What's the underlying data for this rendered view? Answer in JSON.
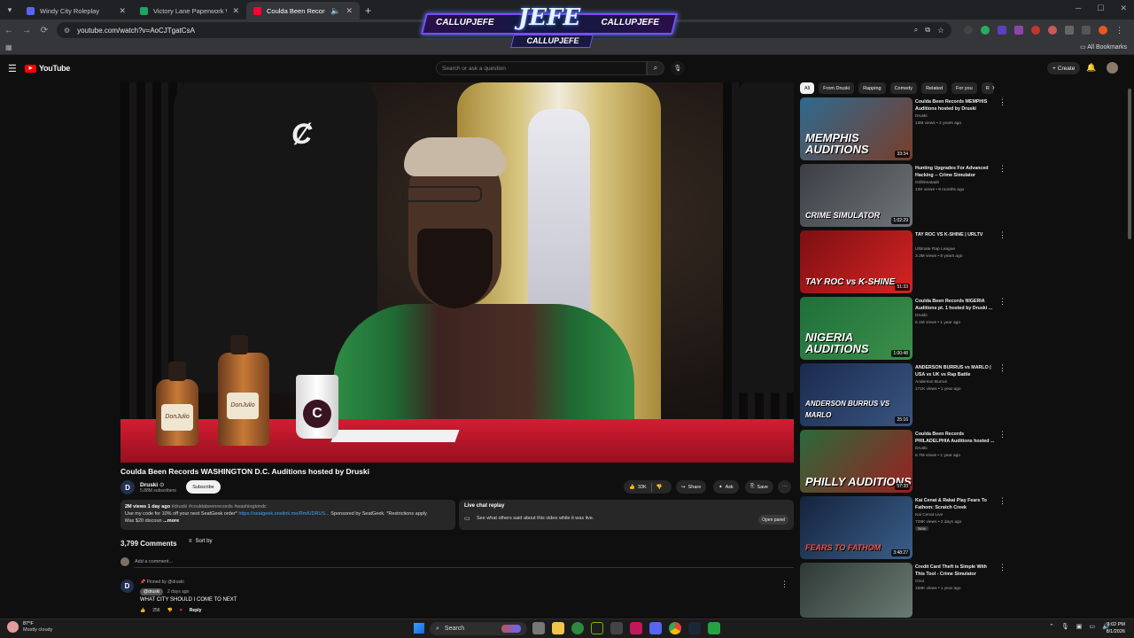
{
  "browser": {
    "tabs": [
      {
        "title": "Windy City Roleplay",
        "favicon_color": "#5865f2"
      },
      {
        "title": "Victory Lane Paperwork WCRP",
        "favicon_color": "#1fa463"
      },
      {
        "title": "Coulda Been Records WASHI",
        "favicon_color": "#ff0033",
        "active": true
      }
    ],
    "url": "youtube.com/watch?v=AoCJTgatCsA",
    "all_bookmarks": "All Bookmarks"
  },
  "overlay": {
    "left_handle": "CALLUPJEFE",
    "right_handle": "CALLUPJEFE",
    "center": "JEFE",
    "sub_handle": "CALLUPJEFE"
  },
  "youtube": {
    "logo_text": "YouTube",
    "search_placeholder": "Search or ask a question",
    "create_label": "Create"
  },
  "video": {
    "overlay_bottle_label": "DonJulio",
    "title": "Coulda Been Records WASHINGTON D.C. Auditions hosted by Druski",
    "channel": {
      "initial": "D",
      "name": "Druski",
      "subscribers": "5.88M subscribers"
    },
    "subscribe_label": "Subscribe",
    "likes": "33K",
    "share_label": "Share",
    "ask_label": "Ask",
    "save_label": "Save",
    "description": {
      "meta": "2M views  1 day ago",
      "tags": "#druski #couldabeenrecords #washingtondc",
      "line1": "Use my code for 10% off your next SeatGeek order*",
      "link": "https://seatgeek.onelink.me/RmK/DRUS...",
      "line1_end": " Sponsored by SeatGeek. *Restrictions apply.",
      "line2": "Max $20 discoun",
      "more": "...more"
    },
    "live_chat": {
      "title": "Live chat replay",
      "desc": "See what others said about this video while it was live.",
      "button": "Open panel"
    }
  },
  "comments": {
    "count": "3,799 Comments",
    "sort_label": "Sort by",
    "add_placeholder": "Add a comment...",
    "pinned": {
      "pinned_by": "Pinned by @druski",
      "author": "@druski",
      "time": "2 days ago",
      "text": "WHAT CITY SHOULD I COME TO NEXT",
      "likes": "256",
      "reply": "Reply"
    }
  },
  "chips": [
    "All",
    "From Druski",
    "Rapping",
    "Comedy",
    "Related",
    "For you",
    "R"
  ],
  "recommendations": [
    {
      "title": "Coulda Been Records MEMPHIS Auditions hosted by Druski",
      "channel": "Druski",
      "stats": "13M views • 2 years ago",
      "duration": "33:34",
      "thumb_text": "MEMPHIS AUDITIONS",
      "thumb_bg": "#2e6a8f",
      "thumb_bg2": "#7a3d2a"
    },
    {
      "title": "Hunting Upgrades For Advanced Hacking -- Crime Simulator",
      "channel": "Grillmeataah",
      "stats": "13K views • 9 months ago",
      "duration": "1:02:29",
      "thumb_text": "CRIME SIMULATOR",
      "thumb_bg": "#3b3f45",
      "thumb_bg2": "#6f7478"
    },
    {
      "title": "TAY ROC VS K-SHINE | URLTV",
      "channel": "Ultimate Rap League",
      "stats": "3.3M views • 8 years ago",
      "duration": "51:33",
      "thumb_text": "TAY ROC vs K-SHINE",
      "thumb_bg": "#7d0f12",
      "thumb_bg2": "#d62424"
    },
    {
      "title": "Coulda Been Records NIGERIA Auditions pt. 1 hosted by Druski ...",
      "channel": "Druski",
      "stats": "6.1M views • 1 year ago",
      "duration": "1:00:48",
      "thumb_text": "NIGERIA AUDITIONS",
      "thumb_bg": "#1f6f3a",
      "thumb_bg2": "#3c8f4a"
    },
    {
      "title": "ANDERSON BURRUS vs MARLO | USA vs UK vs Rap Battle",
      "channel": "Anderson Burrus",
      "stats": "171K views • 1 year ago",
      "duration": "25:16",
      "thumb_text": "ANDERSON BURRUS VS MARLO",
      "thumb_bg": "#1a2b4f",
      "thumb_bg2": "#3a5580"
    },
    {
      "title": "Coulda Been Records PHILADELPHIA Auditions hosted ...",
      "channel": "Druski",
      "stats": "6.7M views • 1 year ago",
      "duration": "57:33",
      "thumb_text": "PHILLY AUDITIONS",
      "thumb_bg": "#2a6a3a",
      "thumb_bg2": "#9a2020"
    },
    {
      "title": "Kai Cenat & Rakai Play Fears To Fathom: Scratch Creek",
      "channel": "Kai Cenat Live",
      "stats": "728K views • 2 days ago",
      "badge": "New",
      "duration": "3:48:27",
      "thumb_text": "FEARS TO FATHOM",
      "thumb_bg": "#15233d",
      "thumb_bg2": "#3a5f8a"
    },
    {
      "title": "Credit Card Theft is Simple With This Tool - Crime Simulator",
      "channel": "Gnoi",
      "stats": "168K views • 1 year ago",
      "duration": "",
      "thumb_text": "",
      "thumb_bg": "#2f3a36",
      "thumb_bg2": "#6b7a73"
    }
  ],
  "taskbar": {
    "temp": "87°F",
    "condition": "Mostly cloudy",
    "search_label": "Search",
    "time": "3:02 PM",
    "date": "8/1/2026"
  }
}
